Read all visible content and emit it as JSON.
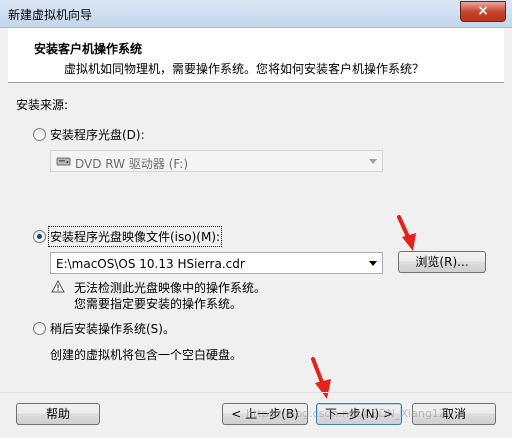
{
  "window": {
    "title": "新建虚拟机向导",
    "close_label": "×"
  },
  "header": {
    "title": "安装客户机操作系统",
    "subtitle": "虚拟机如同物理机，需要操作系统。您将如何安装客户机操作系统？"
  },
  "source": {
    "label": "安装来源:",
    "option_disc": "安装程序光盘(D):",
    "disc_drive": "DVD RW 驱动器 (F:)",
    "option_iso": "安装程序光盘映像文件(iso)(M):",
    "iso_path": "E:\\macOS\\OS 10.13 HSierra.cdr",
    "browse_label": "浏览(R)...",
    "warning_line1": "无法检测此光盘映像中的操作系统。",
    "warning_line2": "您需要指定要安装的操作系统。",
    "option_later": "稍后安装操作系统(S)。",
    "later_desc": "创建的虚拟机将包含一个空白硬盘。",
    "selected": "iso"
  },
  "footer": {
    "help_label": "帮助",
    "back_label": "< 上一步(B)",
    "next_label": "下一步(N) >",
    "cancel_label": "取消",
    "watermark": "https://blog.csdn.net/CSDN_Xiang12"
  },
  "colors": {
    "annotation_arrow": "#e8201a",
    "titlebar": "#c3d6ec",
    "close_button": "#c8452f"
  }
}
